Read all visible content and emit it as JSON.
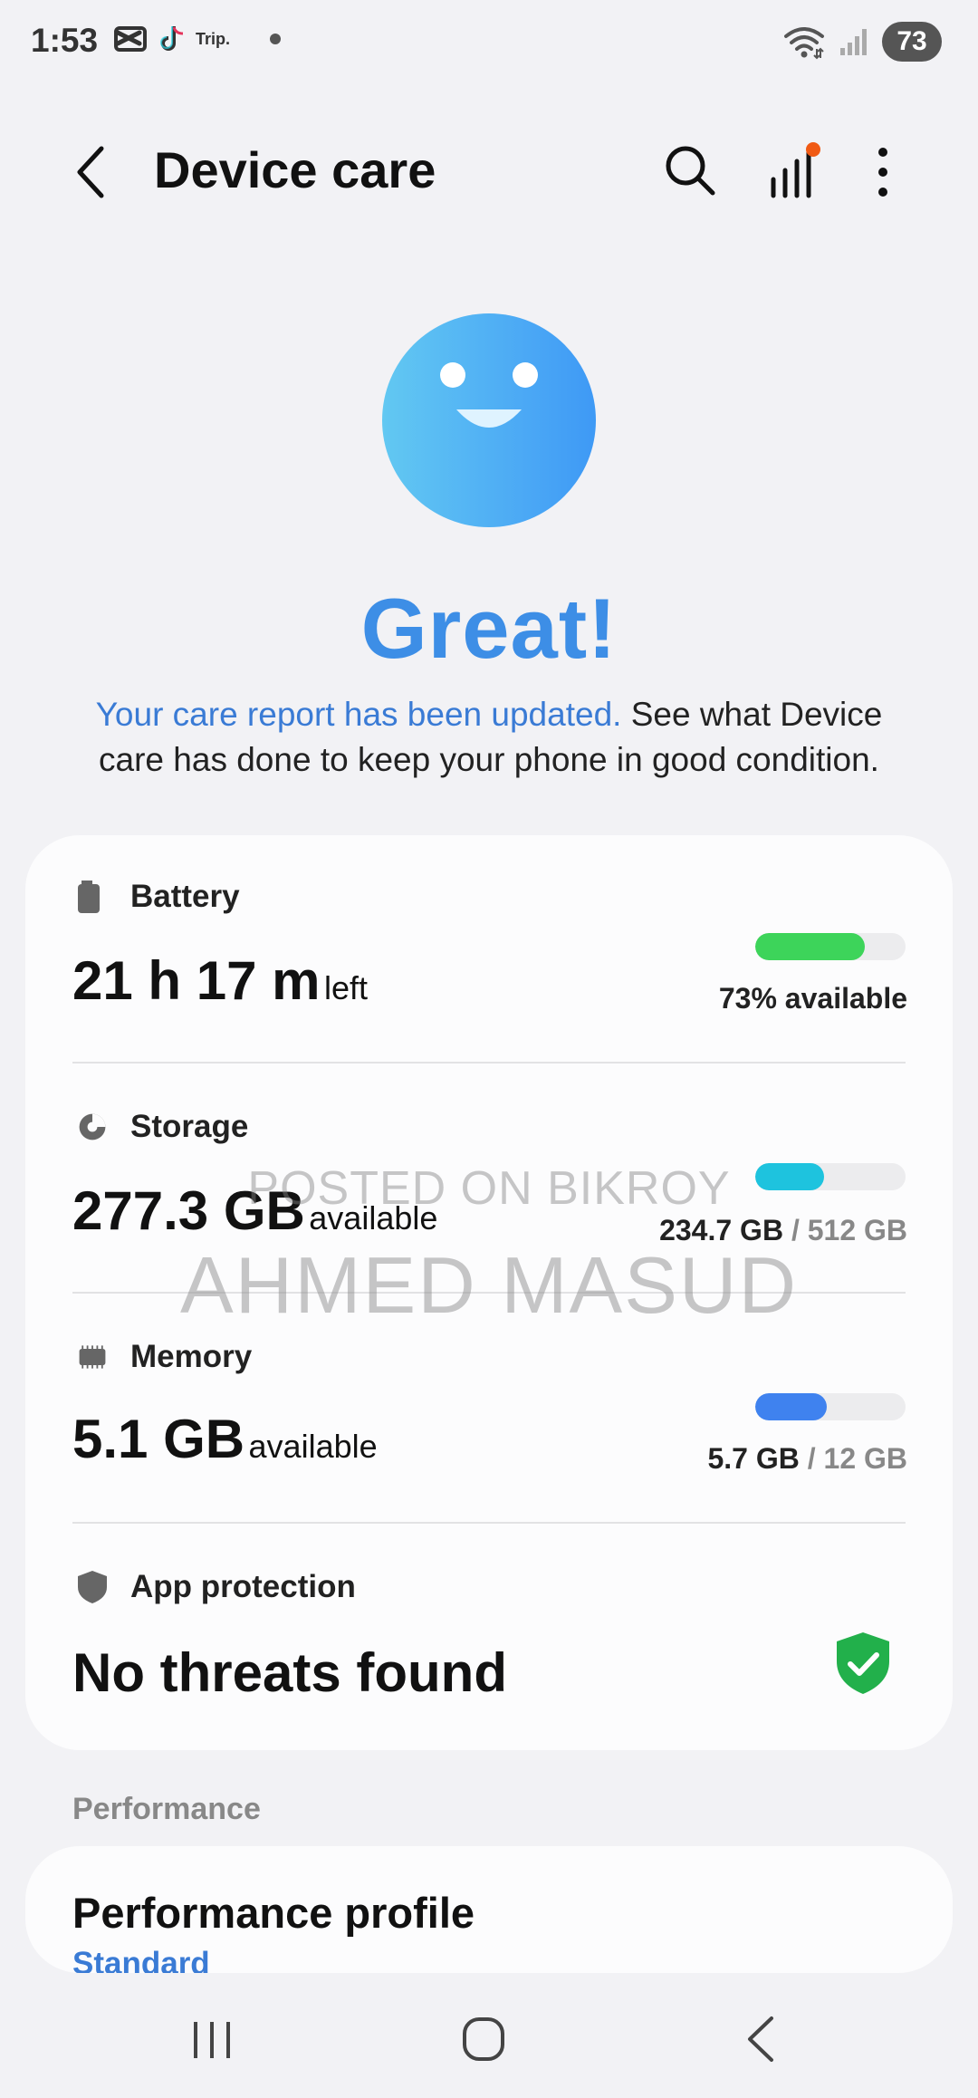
{
  "status_bar": {
    "time": "1:53",
    "trip_label": "Trip.",
    "battery_level": "73"
  },
  "header": {
    "title": "Device care",
    "back_icon": "chevron-left-icon",
    "search_icon": "search-icon",
    "report_icon": "bar-chart-icon",
    "more_icon": "more-vertical-icon"
  },
  "hero": {
    "title": "Great!",
    "highlight": "Your care report has been updated.",
    "text": " See what Device care has done to keep your phone in good condition."
  },
  "battery": {
    "label": "Battery",
    "value": "21 h 17 m",
    "unit": "left",
    "caption": "73% available",
    "fill_fraction": 0.73,
    "color": "#3dd45a"
  },
  "storage": {
    "label": "Storage",
    "value": "277.3 GB",
    "unit": "available",
    "used": "234.7 GB",
    "total": "/ 512 GB",
    "fill_fraction": 0.46,
    "color": "#1ec3de"
  },
  "memory": {
    "label": "Memory",
    "value": "5.1 GB",
    "unit": "available",
    "used": "5.7 GB",
    "total": "/ 12 GB",
    "fill_fraction": 0.475,
    "color": "#3f82ef"
  },
  "app_protection": {
    "label": "App protection",
    "value": "No threats found",
    "status_color": "#22b04b"
  },
  "watermark": {
    "line1": "POSTED ON BIKROY",
    "line2": "AHMED MASUD"
  },
  "performance": {
    "section_label": "Performance",
    "title": "Performance profile",
    "value": "Standard"
  }
}
